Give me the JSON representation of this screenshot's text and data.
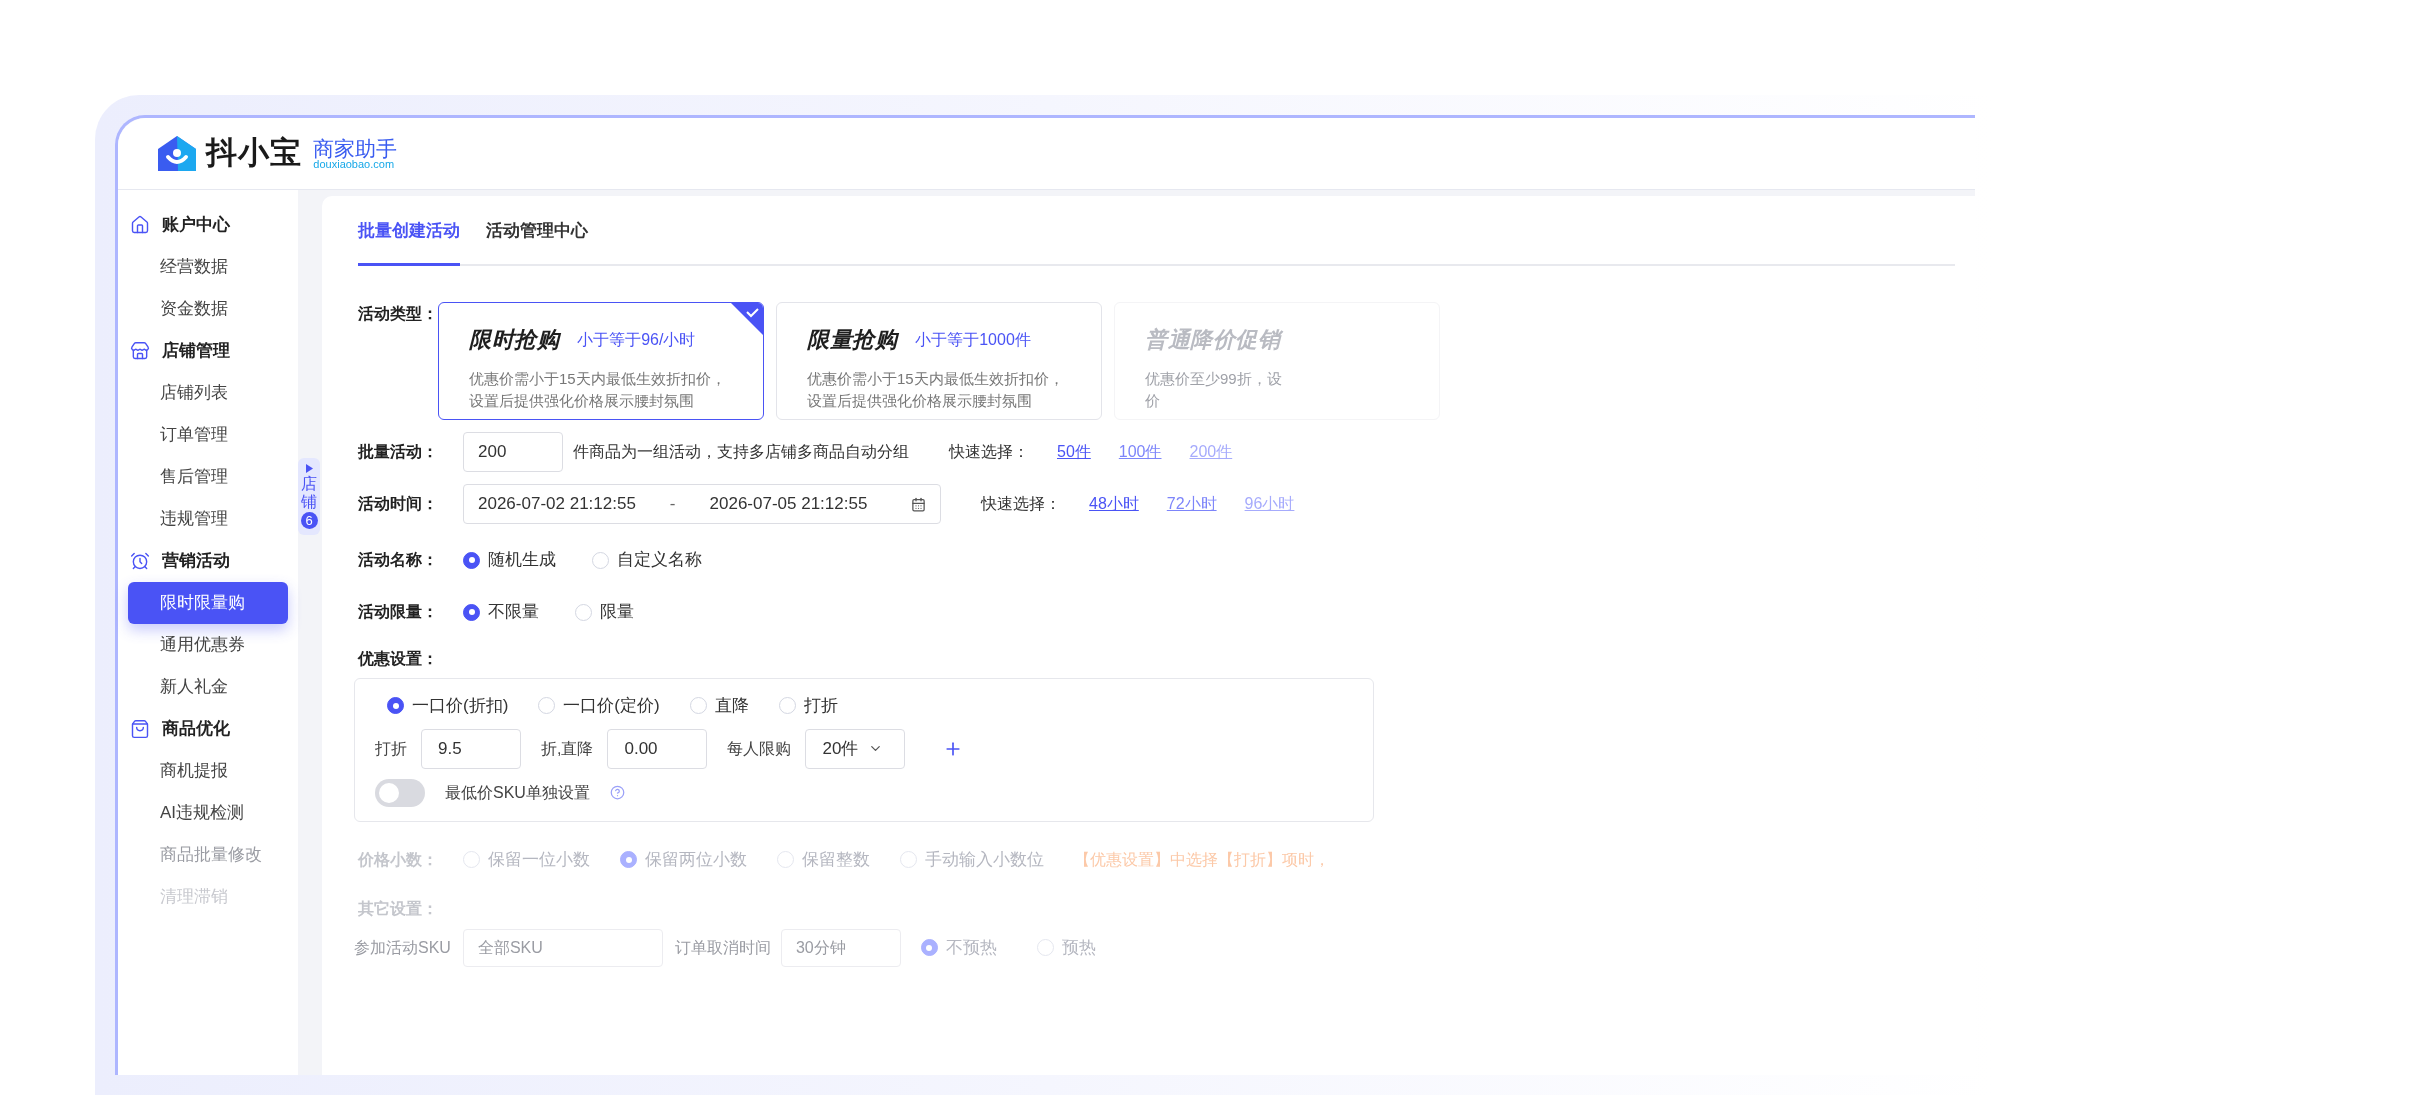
{
  "logo": {
    "name": "抖小宝",
    "tagline": "商家助手",
    "domain": "douxiaobao.com"
  },
  "sidebar": [
    {
      "label": "账户中心",
      "children": [
        {
          "label": "经营数据",
          "selected": false
        },
        {
          "label": "资金数据",
          "selected": false
        }
      ]
    },
    {
      "label": "店铺管理",
      "children": [
        {
          "label": "店铺列表",
          "selected": false
        },
        {
          "label": "订单管理",
          "selected": false
        },
        {
          "label": "售后管理",
          "selected": false
        },
        {
          "label": "违规管理",
          "selected": false
        }
      ]
    },
    {
      "label": "营销活动",
      "children": [
        {
          "label": "限时限量购",
          "selected": true
        },
        {
          "label": "通用优惠券",
          "selected": false
        },
        {
          "label": "新人礼金",
          "selected": false
        }
      ]
    },
    {
      "label": "商品优化",
      "children": [
        {
          "label": "商机提报",
          "selected": false
        },
        {
          "label": "AI违规检测",
          "selected": false
        },
        {
          "label": "商品批量修改",
          "selected": false
        },
        {
          "label": "清理滞销",
          "selected": false
        }
      ]
    }
  ],
  "store_tab": {
    "label": "店铺",
    "count": "6"
  },
  "tabs": [
    {
      "label": "批量创建活动",
      "selected": true
    },
    {
      "label": "活动管理中心",
      "selected": false
    }
  ],
  "activity_type": {
    "label": "活动类型：",
    "cards": [
      {
        "title": "限时抢购",
        "limit": "小于等于96/小时",
        "desc_lines": [
          "优惠价需小于15天内最低生效折扣价，",
          "设置后提供强化价格展示腰封氛围"
        ],
        "selected": true
      },
      {
        "title": "限量抢购",
        "limit": "小于等于1000件",
        "desc_lines": [
          "优惠价需小于15天内最低生效折扣价，",
          "设置后提供强化价格展示腰封氛围"
        ],
        "selected": false
      },
      {
        "title": "普通降价促销",
        "desc_lines": [
          "优惠价至少99折，设",
          "价"
        ],
        "selected": false
      }
    ]
  },
  "batch": {
    "label": "批量活动：",
    "value": "200",
    "hint": "件商品为一组活动，支持多店铺多商品自动分组",
    "quick_label": "快速选择：",
    "quick": [
      "50件",
      "100件",
      "200件"
    ]
  },
  "time": {
    "label": "活动时间：",
    "start": "2026-07-02 21:12:55",
    "separator": "-",
    "end": "2026-07-05 21:12:55",
    "quick_label": "快速选择：",
    "quick": [
      "48小时",
      "72小时",
      "96小时"
    ]
  },
  "name": {
    "label": "活动名称：",
    "options": [
      {
        "label": "随机生成",
        "selected": true
      },
      {
        "label": "自定义名称",
        "selected": false
      }
    ]
  },
  "limit": {
    "label": "活动限量：",
    "options": [
      {
        "label": "不限量",
        "selected": true
      },
      {
        "label": "限量",
        "selected": false
      }
    ]
  },
  "discount": {
    "label": "优惠设置：",
    "options": [
      {
        "label": "一口价(折扣)",
        "selected": true
      },
      {
        "label": "一口价(定价)",
        "selected": false
      },
      {
        "label": "直降",
        "selected": false
      },
      {
        "label": "打折",
        "selected": false
      }
    ],
    "fields": [
      {
        "label": "打折",
        "value": "9.5"
      },
      {
        "label": "折,直降",
        "value": "0.00"
      }
    ],
    "per_person": {
      "label": "每人限购",
      "value": "20件"
    },
    "toggle": {
      "label": "最低价SKU单独设置",
      "on": false
    }
  },
  "decimals": {
    "label": "价格小数：",
    "options": [
      {
        "label": "保留一位小数",
        "selected": false
      },
      {
        "label": "保留两位小数",
        "selected": true
      },
      {
        "label": "保留整数",
        "selected": false
      },
      {
        "label": "手动输入小数位",
        "selected": false
      }
    ],
    "note": "【优惠设置】中选择【打折】项时，"
  },
  "other": {
    "label": "其它设置：",
    "sku": {
      "label": "参加活动SKU",
      "value": "全部SKU"
    },
    "cancel": {
      "label": "订单取消时间",
      "value": "30分钟"
    },
    "preheat": [
      {
        "label": "不预热",
        "selected": true
      },
      {
        "label": "预热",
        "selected": false
      }
    ]
  }
}
